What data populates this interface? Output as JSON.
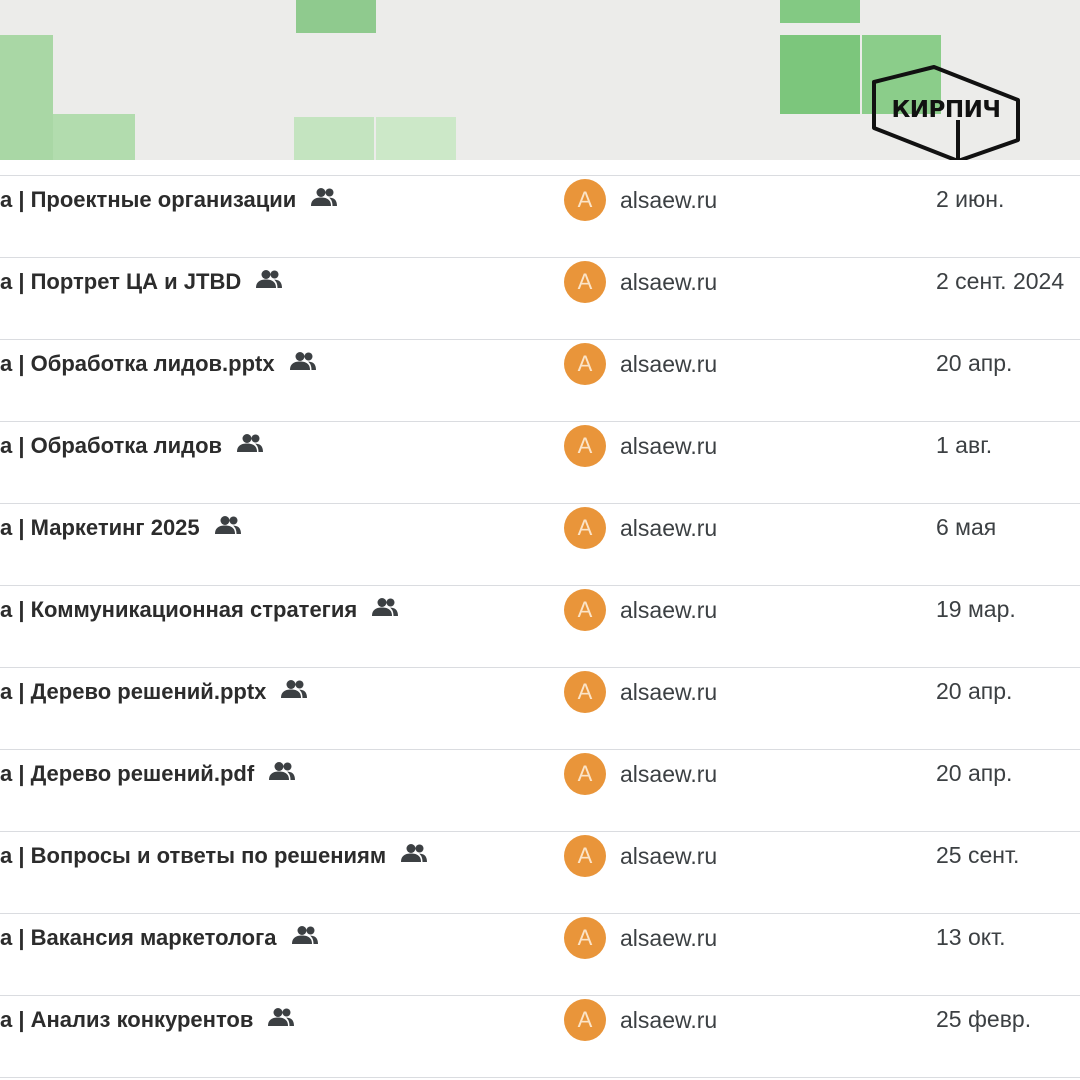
{
  "brand": {
    "logo_text": "КИРПИЧ",
    "accent": "#7cc67c"
  },
  "file_list": {
    "avatar_color": "#e9953a",
    "rows": [
      {
        "name": "а | Проектные организации",
        "shared": true,
        "owner_initial": "A",
        "owner": "alsaew.ru",
        "modified": "2 июн."
      },
      {
        "name": "а | Портрет ЦА и JTBD",
        "shared": true,
        "owner_initial": "A",
        "owner": "alsaew.ru",
        "modified": "2 сент. 2024"
      },
      {
        "name": "а | Обработка лидов.pptx",
        "shared": true,
        "owner_initial": "A",
        "owner": "alsaew.ru",
        "modified": "20 апр."
      },
      {
        "name": "а | Обработка лидов",
        "shared": true,
        "owner_initial": "A",
        "owner": "alsaew.ru",
        "modified": "1 авг."
      },
      {
        "name": "а | Маркетинг 2025",
        "shared": true,
        "owner_initial": "A",
        "owner": "alsaew.ru",
        "modified": "6 мая"
      },
      {
        "name": "а | Коммуникационная стратегия",
        "shared": true,
        "owner_initial": "A",
        "owner": "alsaew.ru",
        "modified": "19 мар."
      },
      {
        "name": "а | Дерево решений.pptx",
        "shared": true,
        "owner_initial": "A",
        "owner": "alsaew.ru",
        "modified": "20 апр."
      },
      {
        "name": "а | Дерево решений.pdf",
        "shared": true,
        "owner_initial": "A",
        "owner": "alsaew.ru",
        "modified": "20 апр."
      },
      {
        "name": "а | Вопросы и ответы по решениям",
        "shared": true,
        "owner_initial": "A",
        "owner": "alsaew.ru",
        "modified": "25 сент."
      },
      {
        "name": "а | Вакансия маркетолога",
        "shared": true,
        "owner_initial": "A",
        "owner": "alsaew.ru",
        "modified": "13 окт."
      },
      {
        "name": "а | Анализ конкурентов",
        "shared": true,
        "owner_initial": "A",
        "owner": "alsaew.ru",
        "modified": "25 февр."
      }
    ]
  }
}
